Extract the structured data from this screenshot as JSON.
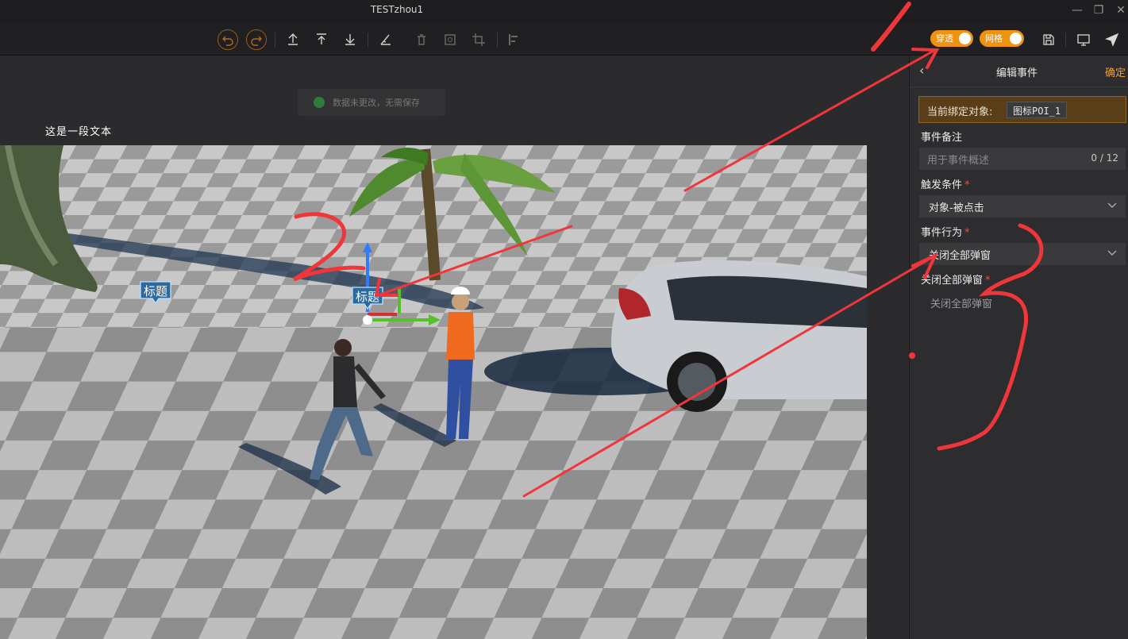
{
  "window": {
    "title": "TESTzhou1",
    "controls": {
      "minimize": "—",
      "restore": "❐",
      "close": "✕"
    }
  },
  "toolbar": {
    "toggles": [
      {
        "label": "穿透",
        "on": true
      },
      {
        "label": "网格",
        "on": true
      }
    ],
    "icons": [
      "undo-icon",
      "redo-icon",
      "upload-icon",
      "upload-top-icon",
      "download-icon",
      "measure-icon",
      "delete-icon",
      "frame-icon",
      "crop-icon",
      "align-icon",
      "save-icon",
      "monitor-icon",
      "send-icon"
    ],
    "accent": "#f0920f"
  },
  "toast": {
    "text": "数据未更改，无需保存"
  },
  "viewport": {
    "text": "这是一段文本",
    "poi_labels": [
      "标题",
      "标题"
    ],
    "annotations": [
      "2",
      "3"
    ]
  },
  "panel": {
    "back": "‹",
    "title": "编辑事件",
    "confirm": "确定",
    "bind_label": "当前绑定对象:",
    "bind_value": "图标POI_1",
    "remark_label": "事件备注",
    "remark_placeholder": "用于事件概述",
    "remark_count": "0 / 12",
    "trigger_label": "触发条件",
    "trigger_value": "对象-被点击",
    "action_label": "事件行为",
    "action_value": "关闭全部弹窗",
    "sub_label": "关闭全部弹窗",
    "sub_value": "关闭全部弹窗",
    "required_mark": "*"
  }
}
